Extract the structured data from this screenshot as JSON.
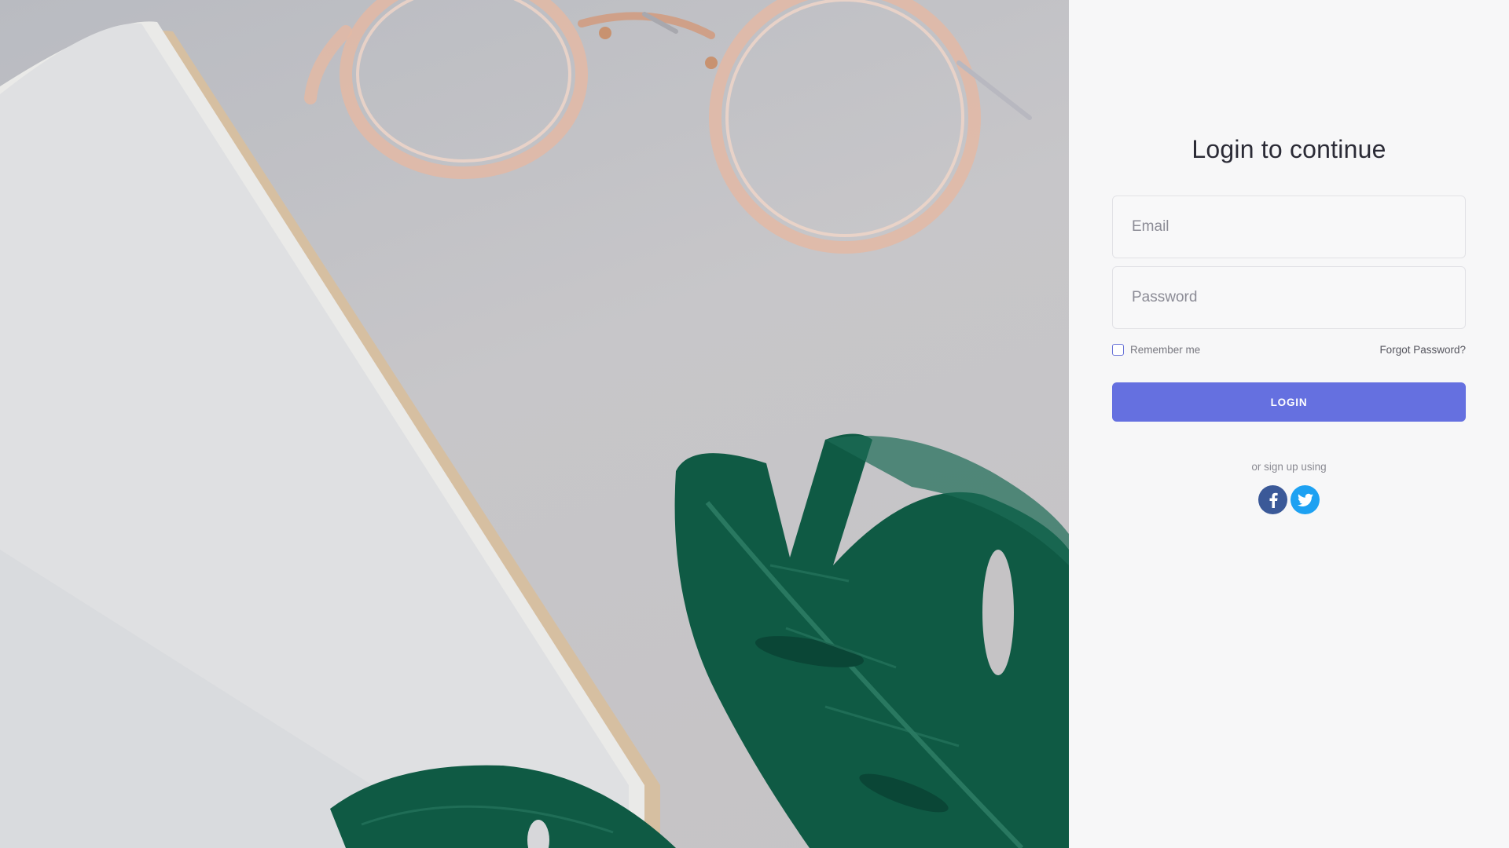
{
  "login": {
    "title": "Login to continue",
    "email_placeholder": "Email",
    "password_placeholder": "Password",
    "remember_label": "Remember me",
    "forgot_label": "Forgot Password?",
    "login_label": "LOGIN",
    "signup_text": "or sign up using",
    "social": [
      {
        "icon": "facebook-icon",
        "color": "#3b5998"
      },
      {
        "icon": "twitter-icon",
        "color": "#1da1f2"
      }
    ]
  },
  "hero": {
    "icons": [
      "glasses",
      "notebook",
      "monstera-leaf"
    ]
  },
  "colors": {
    "accent": "#6570e0",
    "panel_bg": "#f7f7f8",
    "leaf": "#0f5a44"
  }
}
